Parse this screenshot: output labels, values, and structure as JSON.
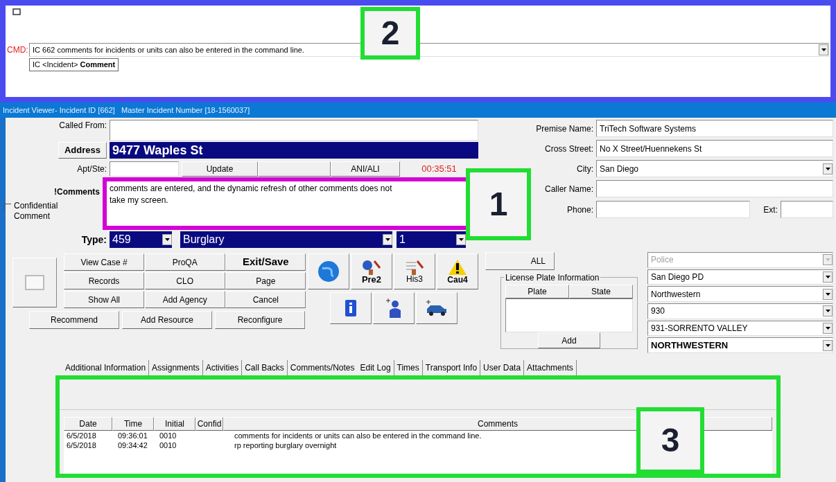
{
  "command_panel": {
    "label": "CMD:",
    "value": "IC 662 comments for incidents or units can also be entered in the command line.",
    "suggestion": "IC <Incident> **Comment**"
  },
  "window": {
    "title": "Incident Viewer- Incident ID [662]   Master Incident Number [18-1560037]"
  },
  "left_form": {
    "called_from_label": "Called From:",
    "address_button": "Address",
    "address_value": "9477 Waples St",
    "apt_label": "Apt/Ste:",
    "update_button": "Update",
    "ani_button": "ANI/ALI",
    "timer": "00:35:51",
    "comments_label": "!Comments",
    "comments_value": "comments are entered, and the dynamic refresh of other comments does not take my screen.",
    "confidential": {
      "label": "Confidential Comment",
      "checked": false
    },
    "type_label": "Type:",
    "type_code": "459",
    "type_name": "Burglary",
    "priority": "1"
  },
  "buttons": [
    {
      "label": "View Case #",
      "bold": false
    },
    {
      "label": "ProQA",
      "bold": false
    },
    {
      "label": "Exit/Save",
      "bold": true
    },
    {
      "label": "Records",
      "bold": false
    },
    {
      "label": "CLO",
      "bold": false
    },
    {
      "label": "Page",
      "bold": false
    },
    {
      "label": "Show All",
      "bold": false
    },
    {
      "label": "Add Agency",
      "bold": false
    },
    {
      "label": "Cancel",
      "bold": false
    }
  ],
  "bottom_buttons": [
    "Recommend",
    "Add Resource",
    "Reconfigure"
  ],
  "icon_buttons": [
    {
      "kind": "globe"
    },
    {
      "kind": "premise",
      "label": "Pre2"
    },
    {
      "kind": "history",
      "label": "His3"
    },
    {
      "kind": "caution",
      "label": "Cau4"
    },
    {
      "kind": "info"
    },
    {
      "kind": "person"
    },
    {
      "kind": "vehicle"
    }
  ],
  "right_form": {
    "fields": [
      {
        "label": "Premise Name:",
        "value": "TriTech Software Systems",
        "kind": "text"
      },
      {
        "label": "Cross Street:",
        "value": "No X Street/Huennekens St",
        "kind": "text"
      },
      {
        "label": "City:",
        "value": "San Diego",
        "kind": "combo"
      },
      {
        "label": "Caller Name:",
        "kind": "text"
      }
    ],
    "phone_label": "Phone:",
    "ext_label": "Ext:",
    "pd_button": "ALL",
    "license_plate": {
      "title": "License Plate Information",
      "columns": [
        "Plate",
        "State"
      ],
      "add_button": "Add"
    },
    "combos": [
      {
        "value": "Police",
        "disabled": true,
        "bold": false
      },
      {
        "value": "San Diego PD",
        "disabled": false,
        "bold": false
      },
      {
        "value": "Northwestern",
        "disabled": false,
        "bold": false
      },
      {
        "value": "930",
        "disabled": false,
        "bold": false
      },
      {
        "value": "931-SORRENTO VALLEY",
        "disabled": false,
        "bold": false
      },
      {
        "value": "NORTHWESTERN",
        "disabled": false,
        "bold": true
      }
    ]
  },
  "tabs": [
    {
      "label": "Additional Information",
      "selected": false
    },
    {
      "label": "Assignments",
      "selected": false
    },
    {
      "label": "Activities",
      "selected": false
    },
    {
      "label": "Call Backs",
      "selected": false
    },
    {
      "label": "Comments/Notes",
      "selected": true
    },
    {
      "label": "Edit Log",
      "selected": false
    },
    {
      "label": "Times",
      "selected": false
    },
    {
      "label": "Transport Info",
      "selected": false
    },
    {
      "label": "User Data",
      "selected": false
    },
    {
      "label": "Attachments",
      "selected": false
    }
  ],
  "comments_table": {
    "columns": [
      "Date",
      "Time",
      "Initial",
      "Confid",
      "Comments"
    ],
    "rows": [
      {
        "date": "6/5/2018",
        "time": "09:36:01",
        "initial": "0010",
        "comment": "comments for incidents or units can also be entered in the command line."
      },
      {
        "date": "6/5/2018",
        "time": "09:34:42",
        "initial": "0010",
        "comment": "rp reporting burglary overnight"
      }
    ]
  },
  "annotations": [
    {
      "label": "2"
    },
    {
      "label": "1"
    },
    {
      "label": "3"
    }
  ]
}
